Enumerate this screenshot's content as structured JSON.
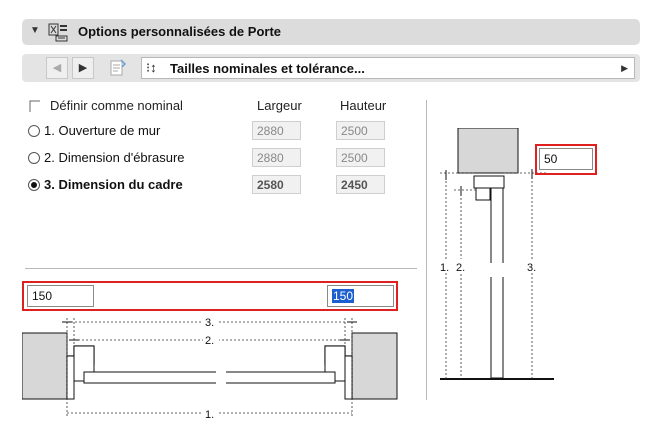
{
  "panel": {
    "title": "Options personnalisées de Porte"
  },
  "toolbar": {
    "dropdown_label": "Tailles nominales et tolérance..."
  },
  "headers": {
    "nominal_label": "Définir comme nominal",
    "largeur": "Largeur",
    "hauteur": "Hauteur"
  },
  "options": [
    {
      "label": "1. Ouverture de mur",
      "largeur": "2880",
      "hauteur": "2500",
      "selected": false
    },
    {
      "label": "2. Dimension d'ébrasure",
      "largeur": "2880",
      "hauteur": "2500",
      "selected": false
    },
    {
      "label": "3. Dimension du cadre",
      "largeur": "2580",
      "hauteur": "2450",
      "selected": true
    }
  ],
  "tolerance": {
    "right_value": "50",
    "left_value": "150",
    "right_plan_value": "150"
  },
  "plan_labels": {
    "l1": "1.",
    "l2": "2.",
    "l3": "3."
  },
  "section_labels": {
    "l1": "1.",
    "l2": "2.",
    "l3": "3."
  },
  "colors": {
    "wall_fill": "#d7d7d7",
    "highlight": "#e02020",
    "selection": "#1c5fd0"
  }
}
